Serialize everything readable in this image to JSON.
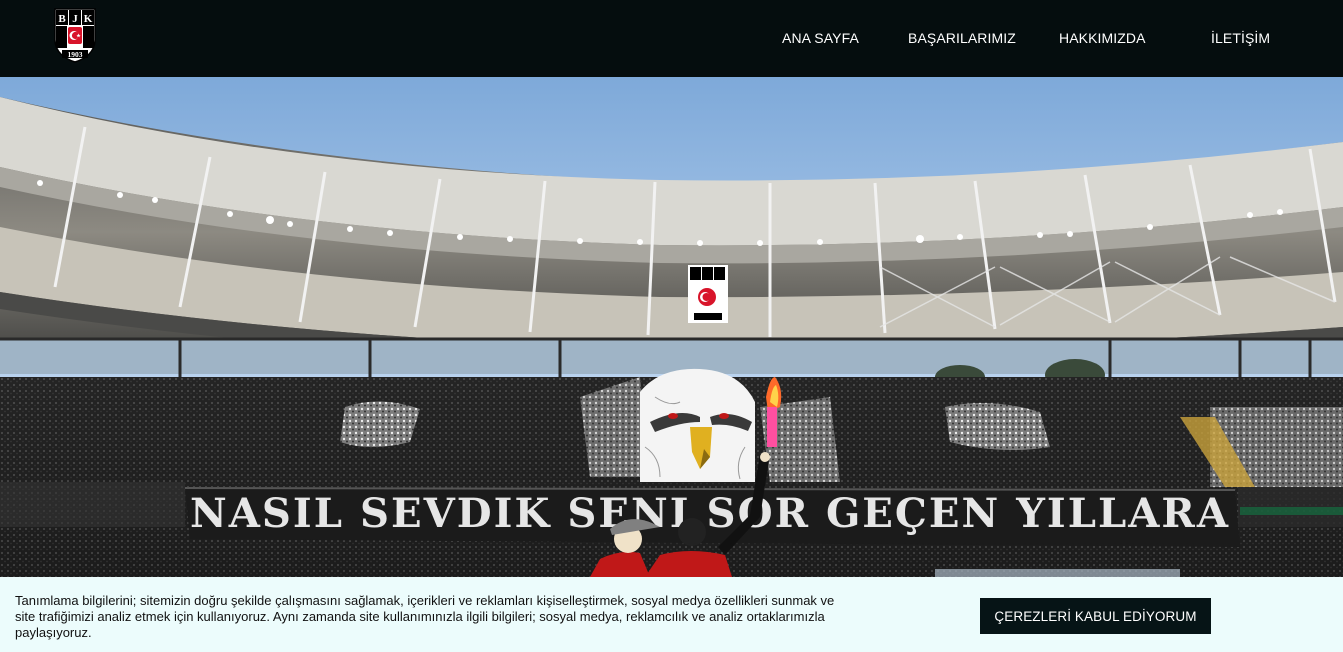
{
  "header": {
    "logo": {
      "name": "bjk-crest",
      "letters": "BJK",
      "year": "1903"
    },
    "nav": [
      {
        "label": "ANA SAYFA"
      },
      {
        "label": "BAŞARILARIMIZ"
      },
      {
        "label": "HAKKIMIZDA"
      },
      {
        "label": "İLETİŞİM"
      }
    ]
  },
  "hero": {
    "banner_text": "NASIL SEVDIK SENI SOR GEÇEN YILLARA",
    "stadium_crest": {
      "letters": "BJK",
      "year": "1903"
    },
    "colors": {
      "sky": "#8fb6e0",
      "roof": "#d7d7d2",
      "crowd": "#1a1a1a",
      "banner": "#1b1b1b"
    }
  },
  "cookie": {
    "text": "Tanımlama bilgilerini; sitemizin doğru şekilde çalışmasını sağlamak, içerikleri ve reklamları kişiselleştirmek, sosyal medya özellikleri sunmak ve site trafiğimizi analiz etmek için kullanıyoruz. Aynı zamanda site kullanımınızla ilgili bilgileri; sosyal medya, reklamcılık ve analiz ortaklarımızla paylaşıyoruz.",
    "accept_label": "ÇEREZLERİ KABUL EDİYORUM"
  }
}
